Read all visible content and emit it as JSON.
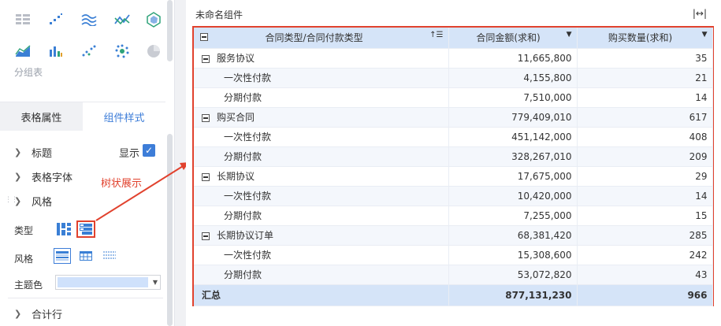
{
  "panel": {
    "group_label": "分组表",
    "tabs": [
      {
        "label": "表格属性",
        "active": false
      },
      {
        "label": "组件样式",
        "active": true
      }
    ],
    "sections": {
      "title": "标题",
      "show_label": "显示",
      "show_checked": true,
      "table_font": "表格字体",
      "style": "风格",
      "type_label": "类型",
      "style_label": "风格",
      "theme_label": "主题色",
      "subtotal": "合计行"
    },
    "annotation": "树状展示",
    "theme_color": "#cfe1fb",
    "accent_color": "#3d7dd8",
    "highlight_color": "#e1422e"
  },
  "component": {
    "title": "未命名组件",
    "expand_icon": "fit-width-icon"
  },
  "table": {
    "headers": [
      "合同类型/合同付款类型",
      "合同金额(求和)",
      "购买数量(求和)"
    ],
    "rows": [
      {
        "level": 0,
        "label": "服务协议",
        "amount": "11,665,800",
        "qty": "35"
      },
      {
        "level": 1,
        "label": "一次性付款",
        "amount": "4,155,800",
        "qty": "21"
      },
      {
        "level": 1,
        "label": "分期付款",
        "amount": "7,510,000",
        "qty": "14"
      },
      {
        "level": 0,
        "label": "购买合同",
        "amount": "779,409,010",
        "qty": "617"
      },
      {
        "level": 1,
        "label": "一次性付款",
        "amount": "451,142,000",
        "qty": "408"
      },
      {
        "level": 1,
        "label": "分期付款",
        "amount": "328,267,010",
        "qty": "209"
      },
      {
        "level": 0,
        "label": "长期协议",
        "amount": "17,675,000",
        "qty": "29"
      },
      {
        "level": 1,
        "label": "一次性付款",
        "amount": "10,420,000",
        "qty": "14"
      },
      {
        "level": 1,
        "label": "分期付款",
        "amount": "7,255,000",
        "qty": "15"
      },
      {
        "level": 0,
        "label": "长期协议订单",
        "amount": "68,381,420",
        "qty": "285"
      },
      {
        "level": 1,
        "label": "一次性付款",
        "amount": "15,308,600",
        "qty": "242"
      },
      {
        "level": 1,
        "label": "分期付款",
        "amount": "53,072,820",
        "qty": "43"
      }
    ],
    "total": {
      "label": "汇总",
      "amount": "877,131,230",
      "qty": "966"
    }
  }
}
